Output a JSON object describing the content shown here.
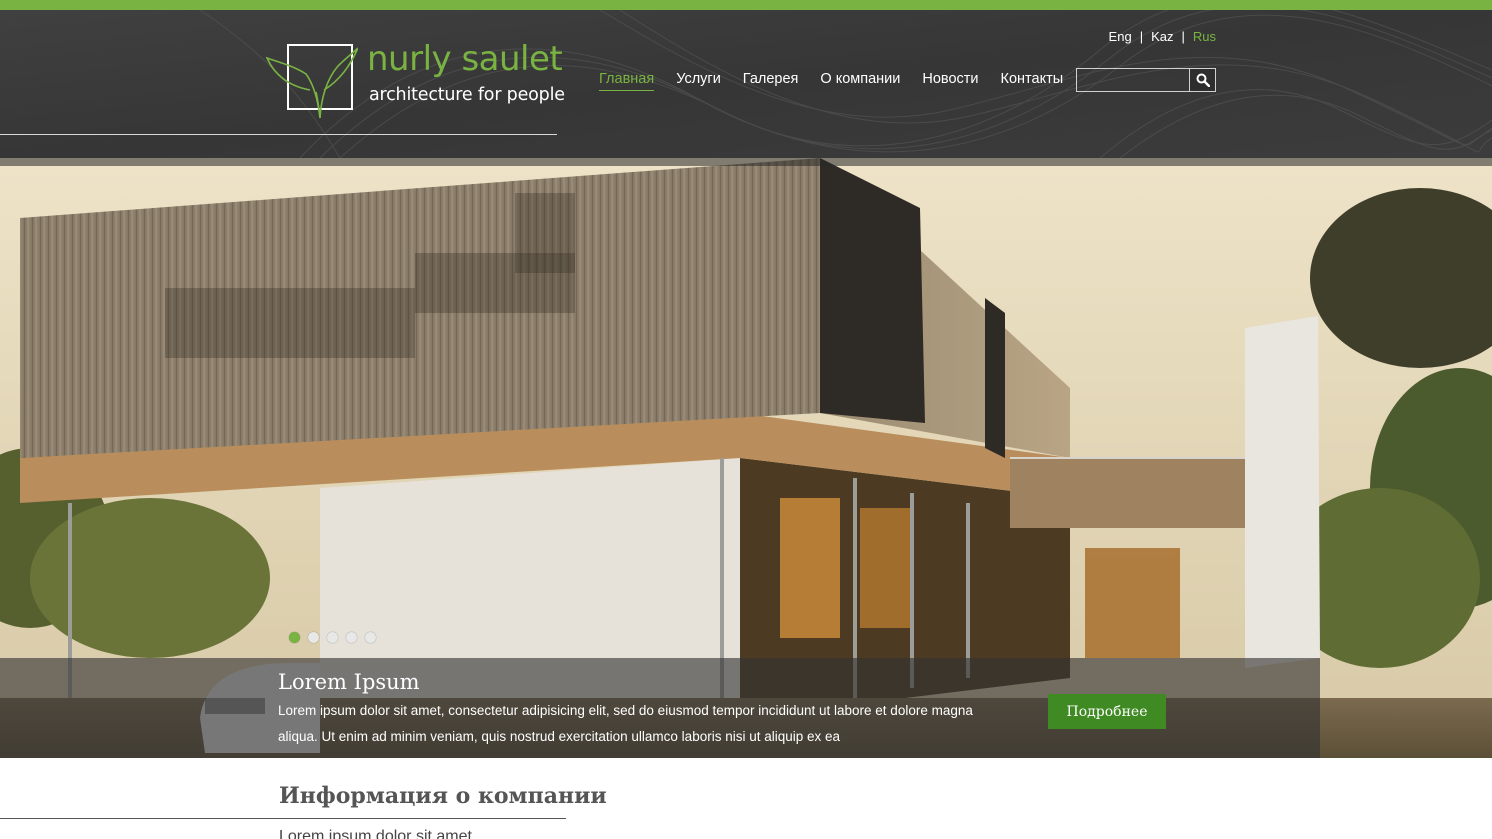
{
  "colors": {
    "accent": "#79b342",
    "header_bg": "#3a3a3a",
    "button_bg": "#3f8a23"
  },
  "logo": {
    "name": "nurly saulet",
    "tagline": "architecture for people",
    "icon": "leaf-in-square-icon"
  },
  "languages": [
    {
      "label": "Eng",
      "active": false
    },
    {
      "label": "Kaz",
      "active": false
    },
    {
      "label": "Rus",
      "active": true
    }
  ],
  "language_separator": "|",
  "nav": [
    {
      "label": "Главная",
      "active": true
    },
    {
      "label": "Услуги",
      "active": false
    },
    {
      "label": "Галерея",
      "active": false
    },
    {
      "label": "О компании",
      "active": false
    },
    {
      "label": "Новости",
      "active": false
    },
    {
      "label": "Контакты",
      "active": false
    }
  ],
  "search": {
    "value": "",
    "placeholder": "",
    "icon": "search-icon"
  },
  "slider": {
    "active_slide": 1,
    "slide_count": 5,
    "title": "Lorem Ipsum",
    "text": "Lorem ipsum dolor sit amet, consectetur adipisicing elit, sed do eiusmod tempor incididunt ut labore et dolore magna aliqua. Ut enim ad minim veniam, quis nostrud exercitation ullamco laboris nisi ut aliquip ex ea",
    "button_label": "Подробнее"
  },
  "company_section": {
    "title": "Информация о компании",
    "text": "Lorem ipsum dolor sit amet"
  }
}
